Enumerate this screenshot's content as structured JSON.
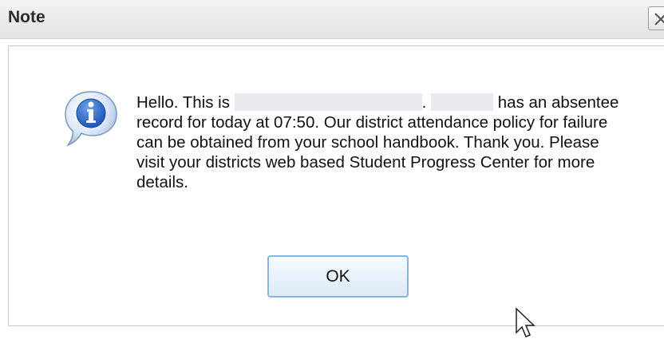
{
  "dialog": {
    "title": "Note",
    "close_icon": "close-icon",
    "message": {
      "part1": "Hello. This is ",
      "part2": ". ",
      "part3": " has an absentee record for today at 07:50. Our district attendance policy for failure can be obtained from your school handbook. Thank you. Please visit your districts web based Student Progress Center for more details."
    },
    "icon": "info-icon",
    "ok_label": "OK"
  }
}
